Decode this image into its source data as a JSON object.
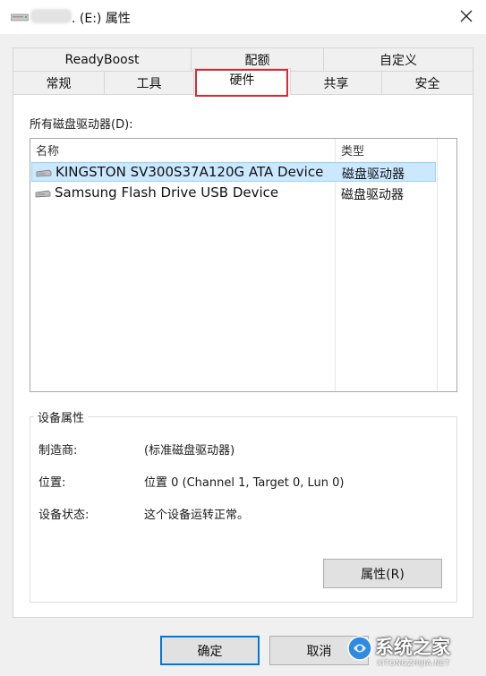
{
  "window": {
    "title": ". (E:) 属性",
    "title_icon": "usb-drive-icon"
  },
  "tabs_row_top": [
    {
      "label": "ReadyBoost"
    },
    {
      "label": "配额"
    },
    {
      "label": "自定义"
    }
  ],
  "tabs_row_bottom": [
    {
      "label": "常规"
    },
    {
      "label": "工具"
    },
    {
      "label": "硬件",
      "active": true
    },
    {
      "label": "共享"
    },
    {
      "label": "安全"
    }
  ],
  "hardware": {
    "list_label": "所有磁盘驱动器(D):",
    "columns": {
      "name": "名称",
      "type": "类型"
    },
    "devices": [
      {
        "name": "KINGSTON SV300S37A120G ATA Device",
        "type": "磁盘驱动器",
        "selected": true,
        "icon": "disk-drive-icon"
      },
      {
        "name": "Samsung Flash Drive USB Device",
        "type": "磁盘驱动器",
        "selected": false,
        "icon": "disk-drive-icon"
      }
    ],
    "properties": {
      "group_title": "设备属性",
      "manufacturer_label": "制造商:",
      "manufacturer_value": "(标准磁盘驱动器)",
      "location_label": "位置:",
      "location_value": "位置 0 (Channel 1, Target 0, Lun 0)",
      "status_label": "设备状态:",
      "status_value": "这个设备运转正常。",
      "properties_button": "属性(R)"
    }
  },
  "footer": {
    "ok_label": "确定",
    "cancel_label": "取消"
  },
  "watermark": {
    "text": "系统之家",
    "subtext": "XITONGZHIJIA.NET"
  },
  "colors": {
    "highlight_box": "#e0262f",
    "selection_bg": "#cce8ff",
    "default_button_border": "#0078d7"
  }
}
